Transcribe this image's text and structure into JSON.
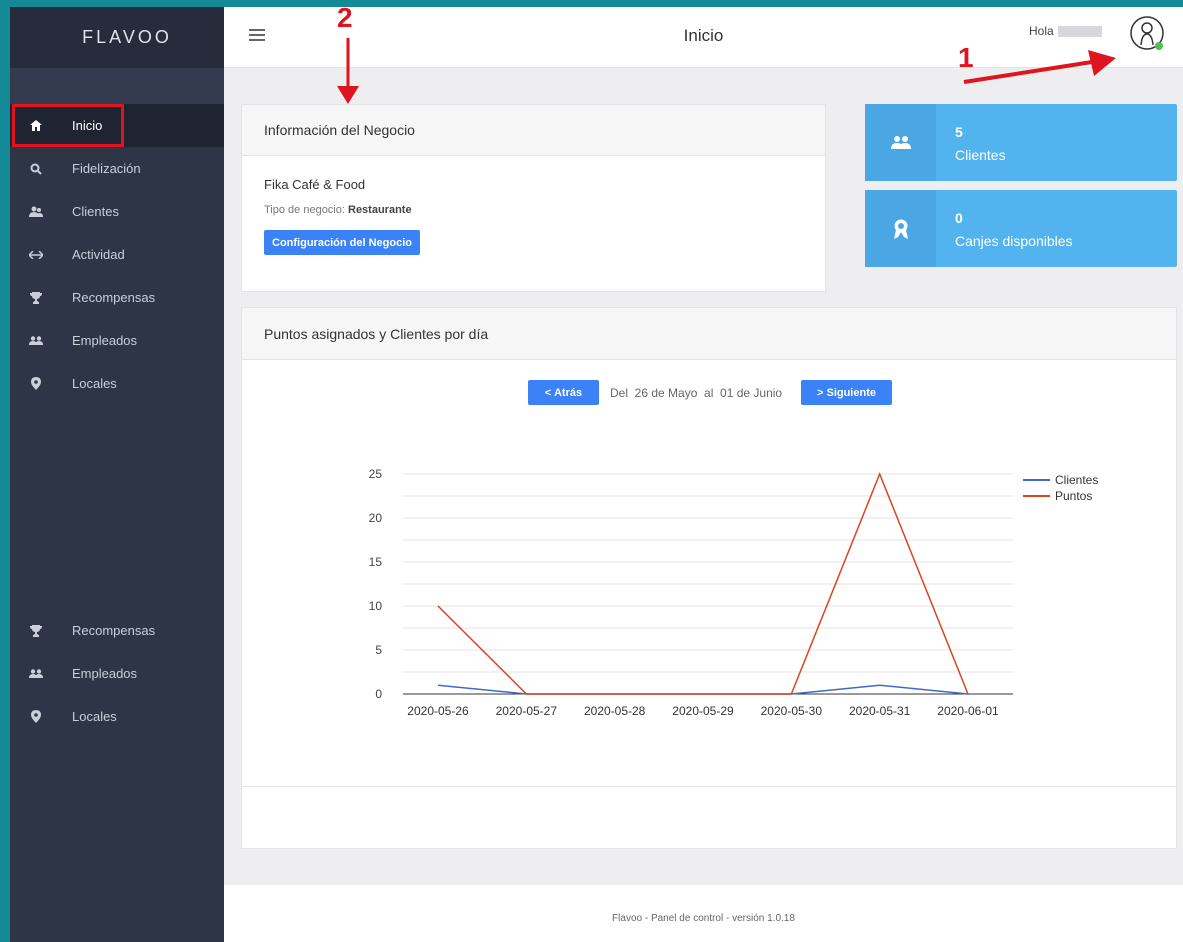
{
  "brand": "FLAVOO",
  "sidebar": {
    "items": [
      {
        "label": "Inicio",
        "icon": "home-icon"
      },
      {
        "label": "Fidelización",
        "icon": "search-icon"
      },
      {
        "label": "Clientes",
        "icon": "users-icon"
      },
      {
        "label": "Actividad",
        "icon": "arrows-icon"
      },
      {
        "label": "Recompensas",
        "icon": "trophy-icon"
      },
      {
        "label": "Empleados",
        "icon": "group-icon"
      },
      {
        "label": "Locales",
        "icon": "map-pin-icon"
      }
    ],
    "items_lower": [
      {
        "label": "Recompensas",
        "icon": "trophy-icon"
      },
      {
        "label": "Empleados",
        "icon": "group-icon"
      },
      {
        "label": "Locales",
        "icon": "map-pin-icon"
      }
    ]
  },
  "header": {
    "title": "Inicio",
    "greeting": "Hola"
  },
  "business": {
    "heading": "Información del Negocio",
    "name": "Fika Café & Food",
    "type_label": "Tipo de negocio:",
    "type_value": "Restaurante",
    "config_button": "Configuración del Negocio"
  },
  "stats": [
    {
      "value": "5",
      "label": "Clientes",
      "icon": "users-icon"
    },
    {
      "value": "0",
      "label": "Canjes disponibles",
      "icon": "award-icon"
    }
  ],
  "chart_card": {
    "heading": "Puntos asignados y Clientes por día",
    "back_label": "< Atrás",
    "range_text": "Del  26 de Mayo  al  01 de Junio",
    "next_label": "> Siguiente"
  },
  "chart_data": {
    "type": "line",
    "x": [
      "2020-05-26",
      "2020-05-27",
      "2020-05-28",
      "2020-05-29",
      "2020-05-30",
      "2020-05-31",
      "2020-06-01"
    ],
    "series": [
      {
        "name": "Clientes",
        "values": [
          1,
          0,
          0,
          0,
          0,
          1,
          0
        ],
        "color": "#3f6bc4"
      },
      {
        "name": "Puntos",
        "values": [
          10,
          0,
          0,
          0,
          0,
          25,
          0
        ],
        "color": "#d8461f"
      }
    ],
    "yticks": [
      0,
      5,
      10,
      15,
      20,
      25
    ],
    "ylim": [
      0,
      25
    ],
    "grid": true,
    "legend": "right"
  },
  "footer": "Flavoo - Panel de control - versión 1.0.18",
  "annotations": {
    "one": "1",
    "two": "2"
  },
  "colors": {
    "accent": "#3b82f6",
    "stat": "#53b3ef",
    "sidebar": "#2e3547",
    "highlight": "#e0141e"
  }
}
